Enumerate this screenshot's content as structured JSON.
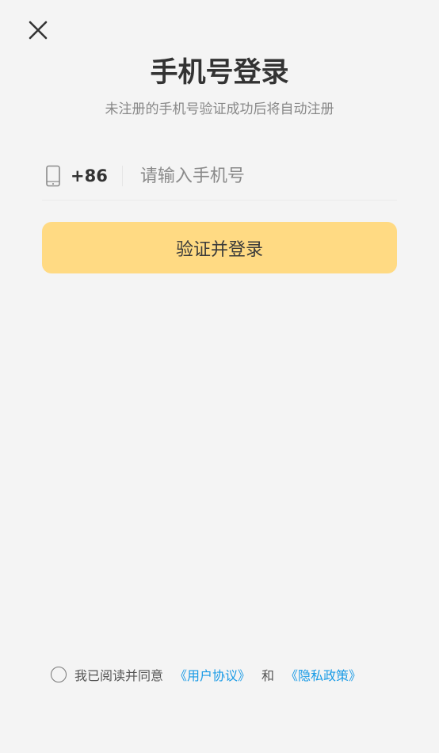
{
  "header": {
    "title": "手机号登录",
    "subtitle": "未注册的手机号验证成功后将自动注册"
  },
  "icons": {
    "close": "close-icon",
    "phone": "mobile-phone-icon"
  },
  "phone_field": {
    "country_code": "+86",
    "placeholder": "请输入手机号",
    "value": ""
  },
  "login_button": {
    "label": "验证并登录",
    "color": "#ffda83"
  },
  "agreement": {
    "checked": false,
    "prefix": "我已阅读并同意",
    "user_agreement": "《用户协议》",
    "conjunction": "和",
    "privacy_policy": "《隐私政策》",
    "link_color": "#1a9be6"
  }
}
